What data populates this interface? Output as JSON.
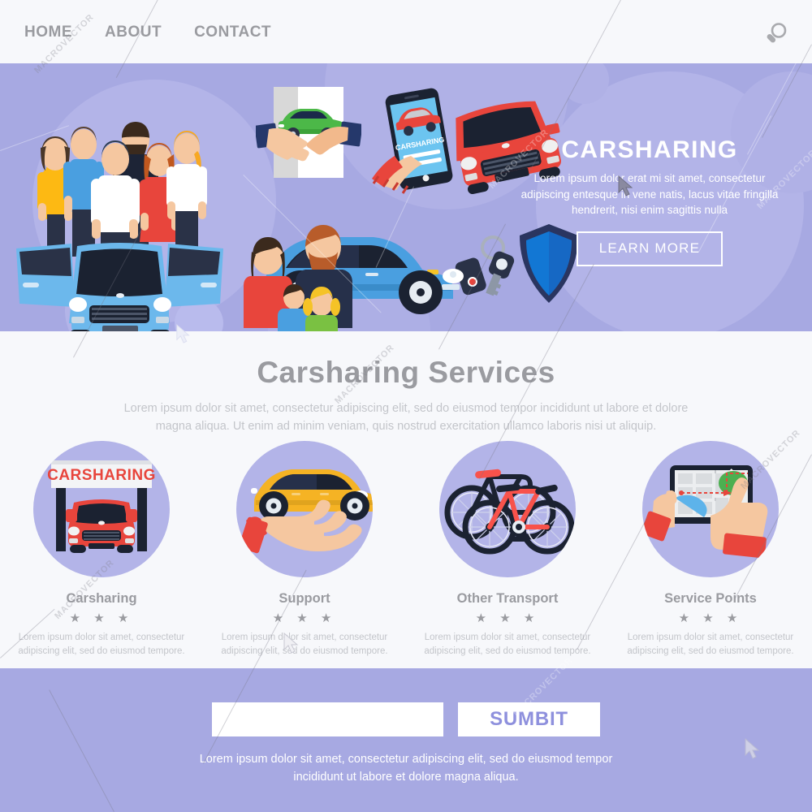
{
  "header": {
    "nav": [
      {
        "label": "HOME"
      },
      {
        "label": "ABOUT"
      },
      {
        "label": "CONTACT"
      }
    ],
    "search_icon": "search-icon"
  },
  "hero": {
    "title": "CARSHARING",
    "description": "Lorem ipsum dolor erat  mi sit amet, consectetur adipiscing entesque in vene natis, lacus vitae fringilla hendrerit, nisi enim sagittis nulla",
    "cta_label": "LEARN MORE",
    "phone_screen_label": "CARSHARING",
    "bg_color": "#a7a9e2",
    "circle_color": "#b3b4e8"
  },
  "services": {
    "title": "Carsharing Services",
    "subtitle": "Lorem ipsum dolor sit amet, consectetur adipiscing elit, sed do eiusmod tempor incididunt ut labore et dolore magna aliqua. Ut enim ad minim veniam, quis nostrud exercitation ullamco laboris nisi ut aliquip.",
    "card_desc": "Lorem ipsum dolor sit amet, consectetur adipiscing elit, sed do eiusmod tempore.",
    "stars": "★ ★ ★",
    "cards": [
      {
        "title": "Carsharing",
        "icon": "carsharing-station-icon",
        "sign_label": "CARSHARING",
        "stars": "★ ★ ★",
        "desc": "Lorem ipsum dolor sit amet, consectetur adipiscing elit, sed do eiusmod tempore."
      },
      {
        "title": "Support",
        "icon": "hand-holding-car-icon",
        "stars": "★ ★ ★",
        "desc": "Lorem ipsum dolor sit amet, consectetur adipiscing elit, sed do eiusmod tempore."
      },
      {
        "title": "Other Transport",
        "icon": "bicycles-icon",
        "stars": "★ ★ ★",
        "desc": "Lorem ipsum dolor sit amet, consectetur adipiscing elit, sed do eiusmod tempore."
      },
      {
        "title": "Service Points",
        "icon": "tablet-map-icon",
        "stars": "★ ★ ★",
        "desc": "Lorem ipsum dolor sit amet, consectetur adipiscing elit, sed do eiusmod tempore."
      }
    ]
  },
  "footer": {
    "input_value": "",
    "input_placeholder": "",
    "submit_label": "SUMBIT",
    "text": "Lorem ipsum dolor sit amet, consectetur adipiscing elit, sed do eiusmod tempor incididunt ut labore et dolore magna aliqua.",
    "bg_color": "#a7a9e2"
  },
  "watermark": {
    "text": "MACROVECTOR"
  }
}
